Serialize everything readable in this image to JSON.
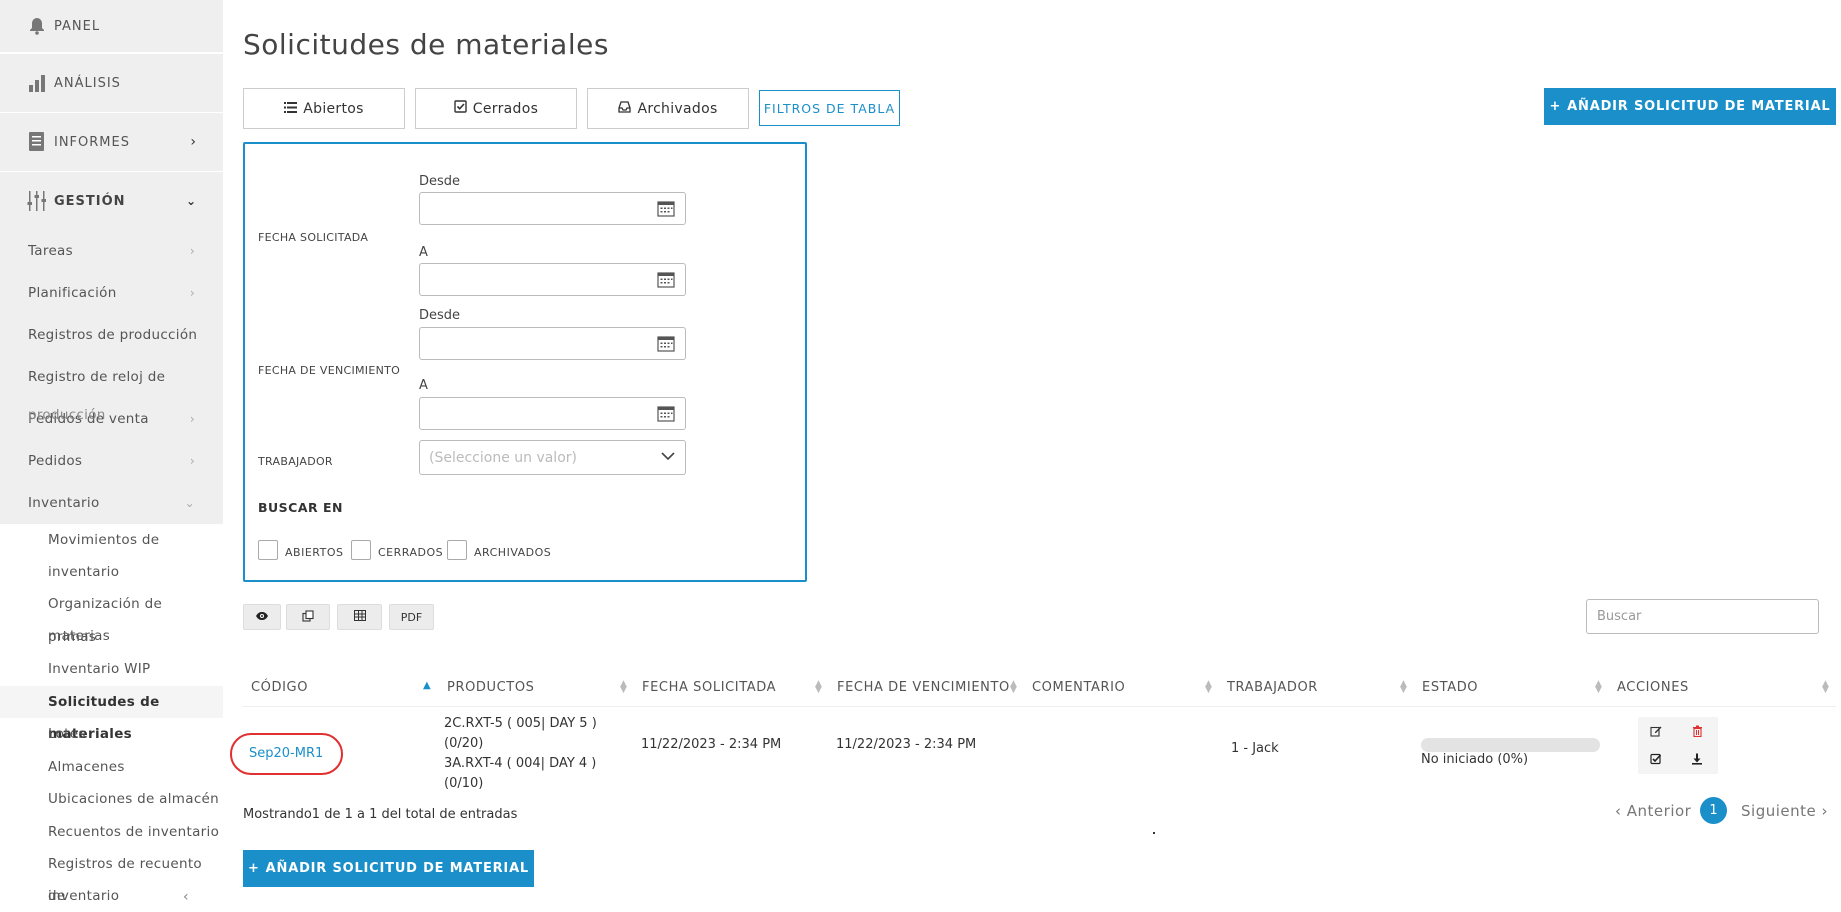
{
  "sidebar": {
    "panel": "PANEL",
    "analisis": "ANÁLISIS",
    "informes": "INFORMES",
    "gestion": "GESTIÓN",
    "sub_items": [
      "Tareas",
      "Planificación",
      "Registros de producción",
      "Registro de reloj de",
      "Pedidos de venta",
      "Pedidos",
      "Inventario"
    ],
    "overlap_text": "producción",
    "inventario_items": [
      "Movimientos de",
      "inventario",
      "Organización de materias",
      "primas",
      "Inventario WIP",
      "Solicitudes de materiales",
      "Lotes",
      "Almacenes",
      "Ubicaciones de almacén",
      "Recuentos de inventario",
      "Registros de recuento de",
      "inventario"
    ]
  },
  "page": {
    "title": "Solicitudes de materiales",
    "tabs": {
      "abiertos": "Abiertos",
      "cerrados": "Cerrados",
      "archivados": "Archivados"
    },
    "filters_button": "FILTROS DE TABLA",
    "add_button": "AÑADIR SOLICITUD DE MATERIAL"
  },
  "filters": {
    "fecha_solicitada": "FECHA SOLICITADA",
    "fecha_vencimiento": "FECHA DE VENCIMIENTO",
    "desde": "Desde",
    "a": "A",
    "trabajador": "TRABAJADOR",
    "trabajador_placeholder": "(Seleccione un valor)",
    "buscar_en": "BUSCAR EN",
    "checkbox_abiertos": "ABIERTOS",
    "checkbox_cerrados": "CERRADOS",
    "checkbox_archivados": "ARCHIVADOS"
  },
  "toolbar": {
    "pdf": "PDF",
    "search_placeholder": "Buscar"
  },
  "table": {
    "headers": [
      "CÓDIGO",
      "PRODUCTOS",
      "FECHA SOLICITADA",
      "FECHA DE VENCIMIENTO",
      "COMENTARIO",
      "TRABAJADOR",
      "ESTADO",
      "ACCIONES"
    ],
    "row": {
      "codigo": "Sep20-MR1",
      "productos_1": "2C.RXT-5 ( 005| DAY 5 )",
      "productos_2": "(0/20)",
      "productos_3": "3A.RXT-4 ( 004| DAY 4 )",
      "productos_4": "(0/10)",
      "fecha_solicitada": "11/22/2023 - 2:34 PM",
      "fecha_vencimiento": "11/22/2023 - 2:34 PM",
      "comentario": "",
      "trabajador": "1 - Jack",
      "estado": "No iniciado (0%)",
      "progress": 0
    },
    "summary": "Mostrando1 de 1 a 1 del total de entradas"
  },
  "pagination": {
    "prev": "Anterior",
    "page": "1",
    "next": "Siguiente"
  },
  "colors": {
    "accent": "#1a8fc9",
    "highlight_circle": "#e03030"
  }
}
